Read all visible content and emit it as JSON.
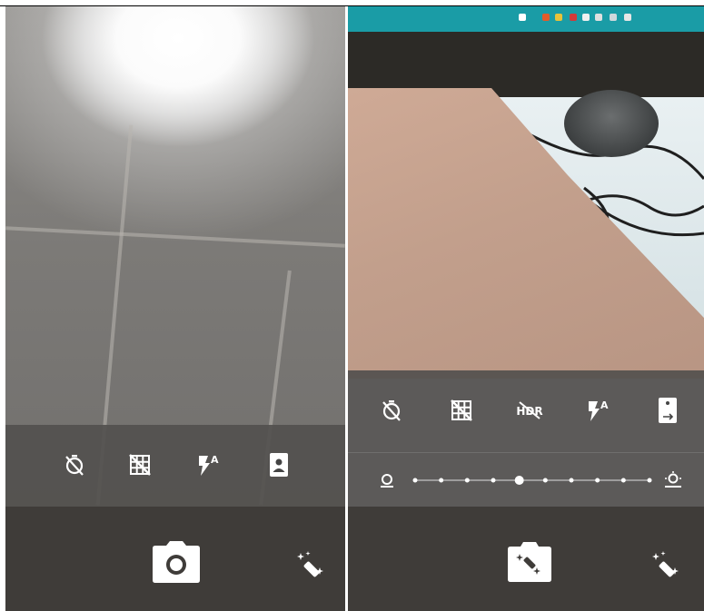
{
  "left_screen": {
    "settings_icons": [
      "timer-off-icon",
      "grid-off-icon",
      "flash-auto-icon",
      "switch-camera-icon"
    ],
    "flash_badge": "A",
    "shutter_icon": "camera-icon",
    "effects_icon": "magic-wand-icon"
  },
  "right_screen": {
    "settings_icons": [
      "timer-off-icon",
      "grid-off-icon",
      "hdr-off-icon",
      "flash-auto-icon",
      "switch-camera-icon"
    ],
    "hdr_label": "HDR",
    "flash_badge": "A",
    "exposure": {
      "steps": 10,
      "selected_step": 5,
      "min_icon": "exposure-low-icon",
      "max_icon": "exposure-high-icon"
    },
    "mode_icon": "effects-camera-icon",
    "effects_icon": "magic-wand-icon"
  }
}
